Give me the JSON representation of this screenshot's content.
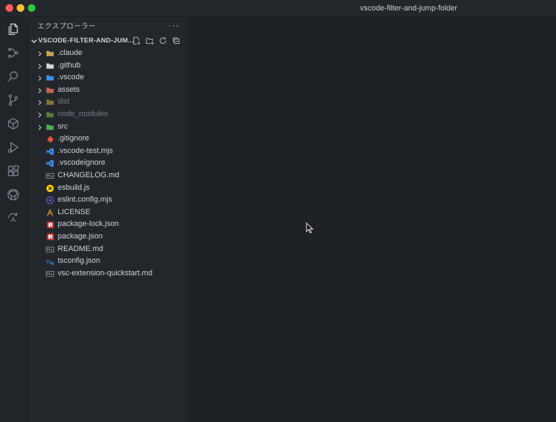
{
  "window": {
    "title": "vscode-filter-and-jump-folder"
  },
  "activity_bar": {
    "items": [
      {
        "icon": "files-icon",
        "active": true
      },
      {
        "icon": "source-control-graph-icon"
      },
      {
        "icon": "search-icon"
      },
      {
        "icon": "git-branch-icon"
      },
      {
        "icon": "cube-icon"
      },
      {
        "icon": "run-debug-icon"
      },
      {
        "icon": "extensions-icon"
      },
      {
        "icon": "github-icon"
      },
      {
        "icon": "remote-icon"
      }
    ]
  },
  "sidebar": {
    "title": "エクスプローラー",
    "more": "···",
    "section_title": "VSCODE-FILTER-AND-JUM...",
    "items": [
      {
        "label": ".claude",
        "folder": true,
        "icon": "folder-claude-icon",
        "color": "#c8a35a"
      },
      {
        "label": ".github",
        "folder": true,
        "icon": "folder-github-icon",
        "color": "#d6d6d6"
      },
      {
        "label": ".vscode",
        "folder": true,
        "icon": "folder-vscode-icon",
        "color": "#3b8eea"
      },
      {
        "label": "assets",
        "folder": true,
        "icon": "folder-assets-icon",
        "color": "#c2655c"
      },
      {
        "label": "dist",
        "folder": true,
        "dim": true,
        "icon": "folder-dist-icon",
        "color": "#e0b040"
      },
      {
        "label": "node_modules",
        "folder": true,
        "dim": true,
        "icon": "folder-node-icon",
        "color": "#8bc34a"
      },
      {
        "label": "src",
        "folder": true,
        "icon": "folder-src-icon",
        "color": "#4caf50"
      },
      {
        "label": ".gitignore",
        "icon": "git-icon",
        "color": "#e5533d"
      },
      {
        "label": ".vscode-test.mjs",
        "icon": "vscode-icon",
        "color": "#3b8eea"
      },
      {
        "label": ".vscodeignore",
        "icon": "vscode-icon",
        "color": "#3b8eea"
      },
      {
        "label": "CHANGELOG.md",
        "icon": "markdown-icon",
        "color": "#9aa0a6"
      },
      {
        "label": "esbuild.js",
        "icon": "esbuild-icon",
        "color": "#ffcf00"
      },
      {
        "label": "eslint.config.mjs",
        "icon": "eslint-icon",
        "color": "#6b5ad6"
      },
      {
        "label": "LICENSE",
        "icon": "license-icon",
        "color": "#e0a030"
      },
      {
        "label": "package-lock.json",
        "icon": "npm-icon",
        "color": "#cb3837"
      },
      {
        "label": "package.json",
        "icon": "npm-icon",
        "color": "#cb3837"
      },
      {
        "label": "README.md",
        "icon": "markdown-icon",
        "color": "#9aa0a6"
      },
      {
        "label": "tsconfig.json",
        "icon": "tsconfig-icon",
        "color": "#3178c6"
      },
      {
        "label": "vsc-extension-quickstart.md",
        "icon": "markdown-icon",
        "color": "#9aa0a6"
      }
    ]
  }
}
